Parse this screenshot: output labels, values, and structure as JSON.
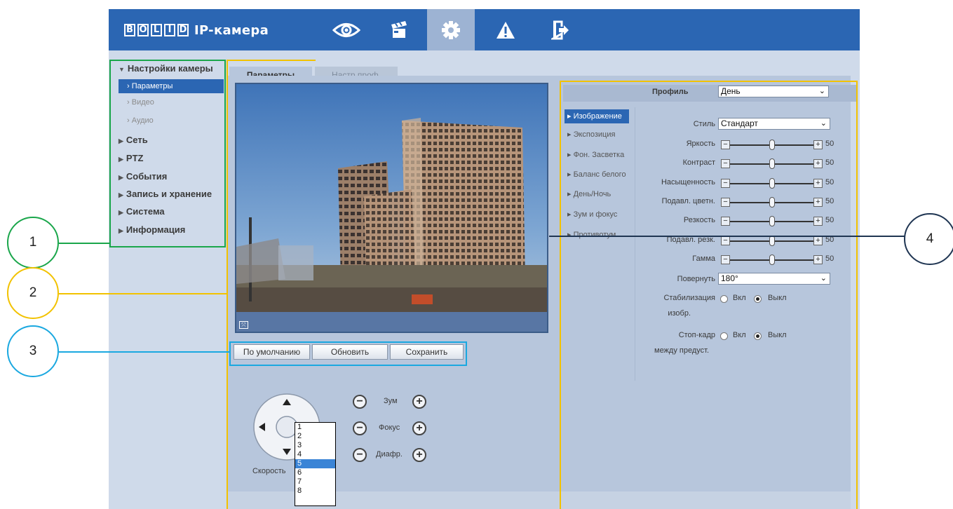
{
  "header": {
    "brand": [
      "B",
      "O",
      "L",
      "I",
      "D"
    ],
    "app_title": "IP-камера",
    "nav": [
      "eye-icon",
      "clapperboard-icon",
      "gear-icon",
      "warning-icon",
      "logout-icon"
    ],
    "accent": "#2b66b3"
  },
  "sidebar": {
    "groups": [
      {
        "label": "Настройки камеры",
        "expanded": true
      },
      {
        "label": "Сеть"
      },
      {
        "label": "PTZ"
      },
      {
        "label": "События"
      },
      {
        "label": "Запись и хранение"
      },
      {
        "label": "Система"
      },
      {
        "label": "Информация"
      }
    ],
    "sub_items": [
      "Параметры",
      "Видео",
      "Аудио"
    ]
  },
  "tabs": [
    "Параметры",
    "Настр.проф."
  ],
  "buttons": {
    "default": "По умолчанию",
    "refresh": "Обновить",
    "save": "Сохранить"
  },
  "profile": {
    "label": "Профиль",
    "value": "День"
  },
  "menu": [
    "Изображение",
    "Экспозиция",
    "Фон. Засветка",
    "Баланс белого",
    "День/Ночь",
    "Зум и фокус",
    "Противотум."
  ],
  "settings": {
    "style": {
      "label": "Стиль",
      "value": "Стандарт"
    },
    "sliders": [
      {
        "label": "Яркость",
        "value": "50"
      },
      {
        "label": "Контраст",
        "value": "50"
      },
      {
        "label": "Насыщенность",
        "value": "50"
      },
      {
        "label": "Подавл. цветн.",
        "value": "50"
      },
      {
        "label": "Резкость",
        "value": "50"
      },
      {
        "label": "Подавл. резк.",
        "value": "50"
      },
      {
        "label": "Гамма",
        "value": "50"
      }
    ],
    "rotate": {
      "label": "Повернуть",
      "value": "180°"
    },
    "stab": {
      "label1": "Стабилизация",
      "label2": "изобр.",
      "on": "Вкл",
      "off": "Выкл"
    },
    "freeze": {
      "label1": "Стоп-кадр",
      "label2": "между предуст.",
      "on": "Вкл",
      "off": "Выкл"
    }
  },
  "ptz": {
    "zoom": "Зум",
    "focus": "Фокус",
    "iris": "Диафр.",
    "speed_label": "Скорость",
    "speed_options": [
      "1",
      "2",
      "3",
      "4",
      "5",
      "6",
      "7",
      "8"
    ],
    "speed_selected": "5"
  },
  "annotations": [
    "1",
    "2",
    "3",
    "4"
  ],
  "annotation_colors": {
    "1": "#1aa64b",
    "2": "#f2c200",
    "3": "#1aa8e0",
    "4": "#1f3552"
  }
}
